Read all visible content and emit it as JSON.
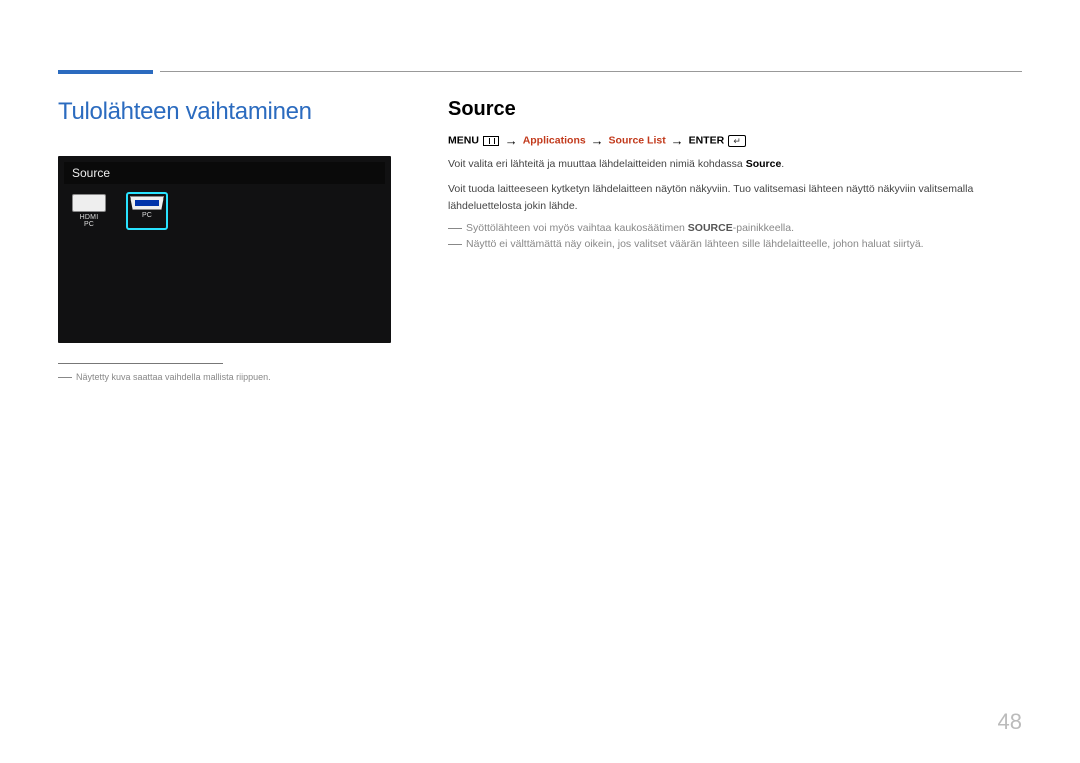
{
  "section_title": "Tulolähteen vaihtaminen",
  "screenshot": {
    "header": "Source",
    "items": [
      {
        "label": "HDMI\nPC",
        "type": "hdmi",
        "selected": false
      },
      {
        "label": "PC",
        "type": "pc",
        "selected": true
      }
    ]
  },
  "footnote": "Näytetty kuva saattaa vaihdella mallista riippuen.",
  "right": {
    "heading": "Source",
    "crumb": {
      "menu": "MENU",
      "seg1": "Applications",
      "seg2": "Source List",
      "enter": "ENTER"
    },
    "p1_a": "Voit valita eri lähteitä ja muuttaa lähdelaitteiden nimiä kohdassa ",
    "p1_b": "Source",
    "p1_c": ".",
    "p2": "Voit tuoda laitteeseen kytketyn lähdelaitteen näytön näkyviin. Tuo valitsemasi lähteen näyttö näkyviin valitsemalla lähdeluettelosta jokin lähde.",
    "n1_a": "Syöttölähteen voi myös vaihtaa kaukosäätimen ",
    "n1_b": "SOURCE",
    "n1_c": "-painikkeella.",
    "n2": "Näyttö ei välttämättä näy oikein, jos valitset väärän lähteen sille lähdelaitteelle, johon haluat siirtyä."
  },
  "page_number": "48"
}
